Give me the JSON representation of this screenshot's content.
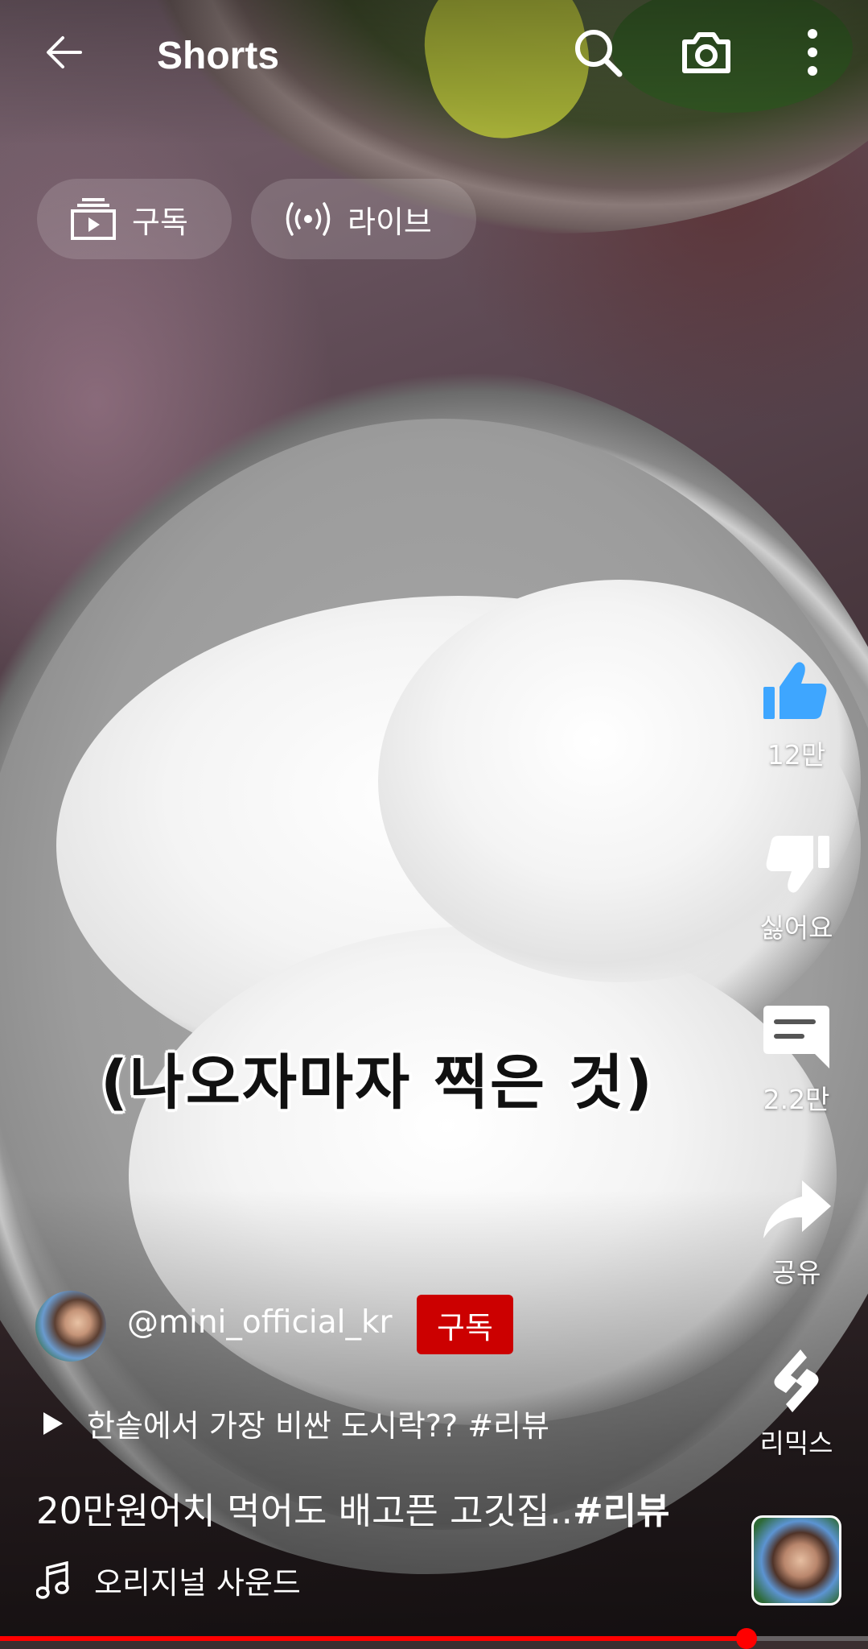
{
  "header": {
    "title": "Shorts",
    "back_icon": "arrow-left-icon",
    "search_icon": "search-icon",
    "camera_icon": "camera-icon",
    "more_icon": "more-vertical-icon"
  },
  "chips": [
    {
      "label": "구독",
      "icon": "subscriptions-icon"
    },
    {
      "label": "라이브",
      "icon": "live-icon"
    }
  ],
  "caption": "(나오자마자 찍은 것)",
  "actions": {
    "like": {
      "label": "12만",
      "icon": "thumb-up-icon",
      "color": "#3ea6ff"
    },
    "dislike": {
      "label": "싫어요",
      "icon": "thumb-down-icon"
    },
    "comments": {
      "label": "2.2만",
      "icon": "comment-icon"
    },
    "share": {
      "label": "공유",
      "icon": "share-icon"
    },
    "remix": {
      "label": "리믹스",
      "icon": "remix-icon"
    }
  },
  "channel": {
    "handle": "@mini_official_kr",
    "subscribe_label": "구독",
    "subscribe_color": "#cc0000"
  },
  "related": {
    "text": "한솥에서 가장 비싼 도시락?? #리뷰",
    "icon": "play-icon"
  },
  "video": {
    "title_text": "20만원어치 먹어도 배고픈 고깃집..",
    "title_tag": "#리뷰"
  },
  "sound": {
    "label": "오리지널 사운드",
    "icon": "music-note-icon"
  },
  "progress": {
    "fraction": 0.86,
    "color": "#ff0000"
  }
}
